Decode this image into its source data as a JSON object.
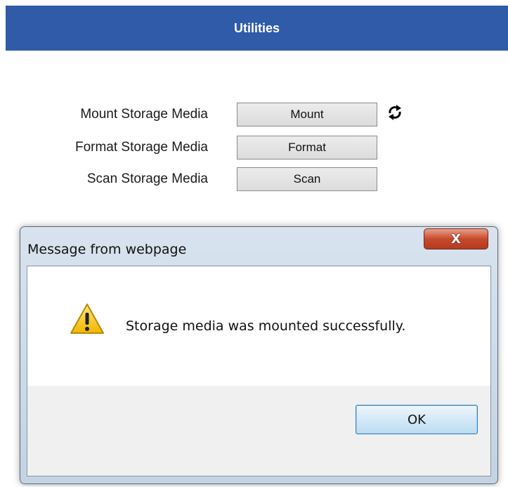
{
  "header": {
    "title": "Utilities"
  },
  "rows": [
    {
      "label": "Mount Storage Media",
      "button": "Mount"
    },
    {
      "label": "Format Storage Media",
      "button": "Format"
    },
    {
      "label": "Scan Storage Media",
      "button": "Scan"
    }
  ],
  "icons": {
    "refresh": "refresh-icon",
    "warning": "warning-icon",
    "close": "close-icon"
  },
  "dialog": {
    "title": "Message from webpage",
    "close_label": "X",
    "message": "Storage media was mounted successfully.",
    "ok_label": "OK"
  },
  "colors": {
    "header_bg": "#2f5ba8",
    "close_red": "#c74a2c",
    "ok_border": "#3c7fb1"
  }
}
